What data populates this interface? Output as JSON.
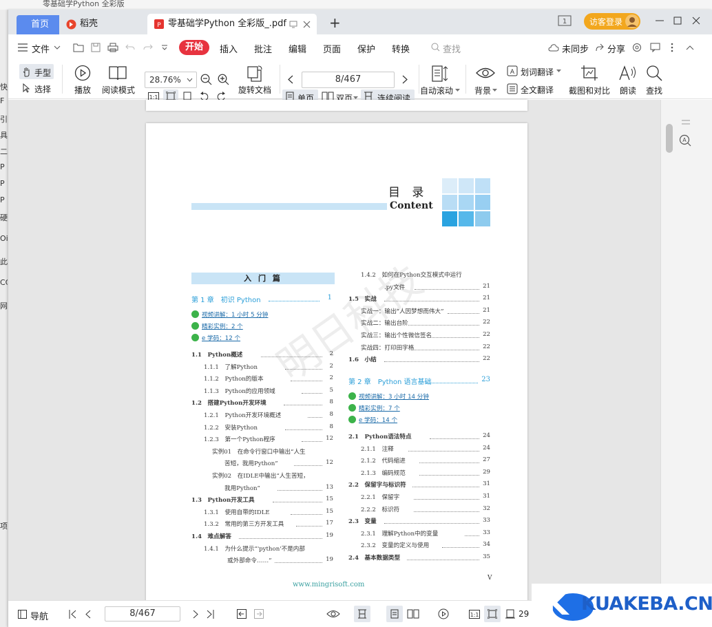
{
  "bg_window": {
    "title": "零基础学Python 全彩版",
    "side_chars": [
      "快",
      "F",
      "引",
      "具",
      "二",
      "P",
      "P",
      "P",
      "硬",
      "Oi",
      "此",
      "CC",
      "网",
      "项"
    ]
  },
  "tabs": {
    "home": "首页",
    "daoke": "稻壳",
    "pdf": "零基础学Python 全彩版_.pdf",
    "add": "+"
  },
  "account": {
    "login": "访客登录"
  },
  "menu": {
    "file": "文件",
    "start": "开始",
    "items": [
      "插入",
      "批注",
      "编辑",
      "页面",
      "保护",
      "转换"
    ],
    "search": "查找",
    "sync": "未同步",
    "share": "分享"
  },
  "toolbar": {
    "hand": "手型",
    "select": "选择",
    "play": "播放",
    "read_mode": "阅读模式",
    "zoom": "28.76%",
    "rotate": "旋转文档",
    "page": "8/467",
    "single": "单页",
    "double": "双页",
    "continuous": "连续阅读",
    "autoscroll": "自动滚动",
    "background": "背景",
    "word_translate": "划词翻译",
    "full_translate": "全文翻译",
    "screenshot": "截图和对比",
    "read_aloud": "朗读",
    "find": "查找"
  },
  "doc": {
    "title_cn": "目 录",
    "title_en": "Content",
    "part": "入 门 篇",
    "ch1": {
      "label": "第 1 章　初识 Python",
      "page": "1"
    },
    "ch1_res": [
      "视频讲解：1 小时 5 分钟",
      "精彩实例：2 个",
      "e 学码：12 个"
    ],
    "left": [
      {
        "t": "1.1　Python概述",
        "p": "2",
        "indent": 0
      },
      {
        "t": "1.1.1　了解Python",
        "p": "2",
        "indent": 1
      },
      {
        "t": "1.1.2　Python的版本",
        "p": "2",
        "indent": 1
      },
      {
        "t": "1.1.3　Python的应用领域",
        "p": "5",
        "indent": 1
      },
      {
        "t": "1.2　搭建Python开发环境",
        "p": "8",
        "indent": 0
      },
      {
        "t": "1.2.1　Python开发环境概述",
        "p": "8",
        "indent": 1
      },
      {
        "t": "1.2.2　安装Python",
        "p": "8",
        "indent": 1
      },
      {
        "t": "1.2.3　第一个Python程序",
        "p": "12",
        "indent": 1
      },
      {
        "t": "实例01　在命令行窗口中输出“人生",
        "p": "",
        "indent": 2
      },
      {
        "t": "苦短，我用Python”",
        "p": "12",
        "indent": 3
      },
      {
        "t": "实例02　在IDLE中输出“人生苦短，",
        "p": "",
        "indent": 2
      },
      {
        "t": "我用Python”",
        "p": "13",
        "indent": 3
      },
      {
        "t": "1.3　Python开发工具",
        "p": "15",
        "indent": 0
      },
      {
        "t": "1.3.1　使用自带的IDLE",
        "p": "15",
        "indent": 1
      },
      {
        "t": "1.3.2　常用的第三方开发工具",
        "p": "17",
        "indent": 1
      },
      {
        "t": "1.4　难点解答",
        "p": "19",
        "indent": 0
      },
      {
        "t": "1.4.1　为什么提示“'python'不是内部",
        "p": "",
        "indent": 1
      },
      {
        "t": "或外部命令……”",
        "p": "19",
        "indent": 4
      }
    ],
    "right": [
      {
        "t": "1.4.2　如何在Python交互模式中运行",
        "p": "",
        "indent": 1
      },
      {
        "t": ".py文件",
        "p": "21",
        "indent": 4
      },
      {
        "t": "1.5　实战",
        "p": "21",
        "indent": 0
      },
      {
        "t": "实战一：输出“人因梦想而伟大”",
        "p": "21",
        "indent": 1
      },
      {
        "t": "实战二：输出台阶",
        "p": "22",
        "indent": 1
      },
      {
        "t": "实战三：输出个性微信签名",
        "p": "22",
        "indent": 1
      },
      {
        "t": "实战四：打印田字格",
        "p": "22",
        "indent": 1
      },
      {
        "t": "1.6　小结",
        "p": "22",
        "indent": 0
      }
    ],
    "ch2": {
      "label": "第 2 章　Python 语言基础",
      "page": "23"
    },
    "ch2_res": [
      "视频讲解：3 小时 14 分钟",
      "精彩实例：7 个",
      "e 学码：14 个"
    ],
    "right2": [
      {
        "t": "2.1　Python语法特点",
        "p": "24",
        "indent": 0
      },
      {
        "t": "2.1.1　注释",
        "p": "24",
        "indent": 1
      },
      {
        "t": "2.1.2　代码缩进",
        "p": "27",
        "indent": 1
      },
      {
        "t": "2.1.3　编码规范",
        "p": "29",
        "indent": 1
      },
      {
        "t": "2.2　保留字与标识符",
        "p": "31",
        "indent": 0
      },
      {
        "t": "2.2.1　保留字",
        "p": "31",
        "indent": 1
      },
      {
        "t": "2.2.2　标识符",
        "p": "32",
        "indent": 1
      },
      {
        "t": "2.3　变量",
        "p": "33",
        "indent": 0
      },
      {
        "t": "2.3.1　理解Python中的变量",
        "p": "33",
        "indent": 1
      },
      {
        "t": "2.3.2　变量的定义与使用",
        "p": "34",
        "indent": 1
      },
      {
        "t": "2.4　基本数据类型",
        "p": "35",
        "indent": 0
      }
    ],
    "footer_url": "www.mingrisoft.com",
    "page_roman": "V",
    "watermark": "明日科技"
  },
  "status": {
    "nav": "导航",
    "page": "8/467",
    "zoom": "29"
  },
  "logo": {
    "text": "KUAKEBA.CN",
    "letter": "K"
  },
  "colors": {
    "accent": "#5b8bee",
    "start": "#e7333f",
    "toc_blue": "#2a9ed8",
    "light_blue": "#c9e4f6"
  }
}
